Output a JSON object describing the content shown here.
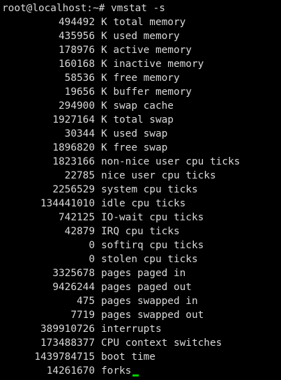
{
  "terminal": {
    "prompt": "root@localhost:~# vmstat -s",
    "cursor_color": "#00d000",
    "rows": [
      {
        "value": "494492",
        "label": "K total memory"
      },
      {
        "value": "435956",
        "label": "K used memory"
      },
      {
        "value": "178976",
        "label": "K active memory"
      },
      {
        "value": "160168",
        "label": "K inactive memory"
      },
      {
        "value": "58536",
        "label": "K free memory"
      },
      {
        "value": "19656",
        "label": "K buffer memory"
      },
      {
        "value": "294900",
        "label": "K swap cache"
      },
      {
        "value": "1927164",
        "label": "K total swap"
      },
      {
        "value": "30344",
        "label": "K used swap"
      },
      {
        "value": "1896820",
        "label": "K free swap"
      },
      {
        "value": "1823166",
        "label": "non-nice user cpu ticks"
      },
      {
        "value": "22785",
        "label": "nice user cpu ticks"
      },
      {
        "value": "2256529",
        "label": "system cpu ticks"
      },
      {
        "value": "134441010",
        "label": "idle cpu ticks"
      },
      {
        "value": "742125",
        "label": "IO-wait cpu ticks"
      },
      {
        "value": "42879",
        "label": "IRQ cpu ticks"
      },
      {
        "value": "0",
        "label": "softirq cpu ticks"
      },
      {
        "value": "0",
        "label": "stolen cpu ticks"
      },
      {
        "value": "3325678",
        "label": "pages paged in"
      },
      {
        "value": "9426244",
        "label": "pages paged out"
      },
      {
        "value": "475",
        "label": "pages swapped in"
      },
      {
        "value": "7719",
        "label": "pages swapped out"
      },
      {
        "value": "389910726",
        "label": "interrupts"
      },
      {
        "value": "173488377",
        "label": "CPU context switches"
      },
      {
        "value": "1439784715",
        "label": "boot time"
      },
      {
        "value": "14261670",
        "label": "forks"
      }
    ]
  }
}
